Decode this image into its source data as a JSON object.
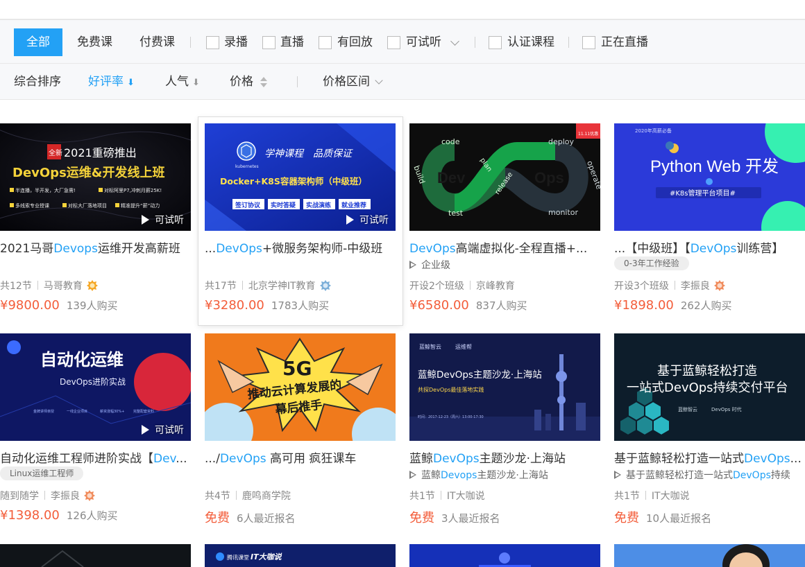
{
  "filters": {
    "all": "全部",
    "free": "免费课",
    "paid": "付费课",
    "recorded": "录播",
    "live": "直播",
    "replay": "有回放",
    "trial": "可试听",
    "certified": "认证课程",
    "live_now": "正在直播"
  },
  "sort": {
    "overall": "综合排序",
    "rating": "好评率",
    "popularity": "人气",
    "price": "价格",
    "price_range": "价格区间",
    "active": "rating"
  },
  "colors": {
    "accent": "#23a1f5",
    "price": "#f35d3a"
  },
  "courses": [
    {
      "title_parts": [
        "2021马哥",
        "Devops",
        "运维开发高薪班"
      ],
      "thumb": {
        "badge": "全新",
        "line1": "2021重磅推出",
        "line2": "DevOps运维&开发线上班",
        "bullets": [
          "半连播，半开发，大厂急需!",
          "对标阿里P7,冲刺月薪25K!",
          "多线索专业授课",
          "对标大厂落地项目",
          "精准提升“薪”动力"
        ]
      },
      "trial": "可试听",
      "meta": [
        "共12节",
        "马哥教育"
      ],
      "price": "¥9800.00",
      "buyers": "139人购买"
    },
    {
      "title_parts": [
        "...",
        "DevOps",
        "+微服务架构师-中级班"
      ],
      "thumb": {
        "logo": "kubernetes",
        "headline": "学神课程　品质保证",
        "line2": "Docker+K8S容器架构师（中级班）",
        "chips": [
          "签订协议",
          "实时答疑",
          "实战演练",
          "就业推荐"
        ]
      },
      "trial": "可试听",
      "meta": [
        "共17节",
        "北京学神IT教育"
      ],
      "price": "¥3280.00",
      "buyers": "1783人购买"
    },
    {
      "title_parts": [
        "",
        "DevOps",
        "高端虚拟化-全程直播+..."
      ],
      "thumb": {
        "words": [
          "code",
          "build",
          "plan",
          "test",
          "release",
          "deploy",
          "operate",
          "monitor",
          "Dev",
          "Ops"
        ],
        "corner": "11.11优惠"
      },
      "sub": "企业级",
      "meta": [
        "开设2个班级",
        "京峰教育"
      ],
      "price": "¥6580.00",
      "buyers": "837人购买"
    },
    {
      "title_parts": [
        "...【中级班】【",
        "DevOps",
        "训练营】"
      ],
      "thumb": {
        "top": "2020年高薪必备",
        "headline": "Python Web 开发",
        "sub": "#K8s管理平台项目#"
      },
      "tag": "0-3年工作经验",
      "meta": [
        "开设3个班级",
        "李振良"
      ],
      "price": "¥1898.00",
      "buyers": "262人购买"
    },
    {
      "title_parts": [
        "自动化运维工程师进阶实战【",
        "Dev",
        "..."
      ],
      "thumb": {
        "headline": "自动化运维",
        "sub": "DevOps进阶实战",
        "chips": [
          "金牌讲师亲授",
          "一线企业项目",
          "薪资涨幅30%+",
          "完整配套资料"
        ]
      },
      "trial": "可试听",
      "tag": "Linux运维工程师",
      "meta": [
        "随到随学",
        "李振良"
      ],
      "price": "¥1398.00",
      "buyers": "126人购买"
    },
    {
      "title_parts": [
        ".../",
        "DevOps",
        " 高可用 疯狂课车"
      ],
      "thumb": {
        "big": "5G",
        "line1": "推动云计算发展的",
        "line2": "幕后推手"
      },
      "meta": [
        "共4节",
        "鹿鸣商学院"
      ],
      "price": "免费",
      "buyers": "6人最近报名"
    },
    {
      "title_parts": [
        "蓝鲸",
        "DevOps",
        "主题沙龙·上海站"
      ],
      "thumb": {
        "brand": "蓝鲸智云",
        "brand2": "运维帮",
        "headline": "蓝鲸DevOps主题沙龙·上海站",
        "sub": "共探DevOps最佳落地实践",
        "time": "时间：2017-12-23（周六）13:00-17:30"
      },
      "sub_parts": [
        "蓝鲸",
        "Devops",
        "主题沙龙·上海站"
      ],
      "meta": [
        "共1节",
        "IT大咖说"
      ],
      "price": "免费",
      "buyers": "3人最近报名"
    },
    {
      "title_parts": [
        "基于蓝鲸轻松打造一站式",
        "DevOps",
        "..."
      ],
      "thumb": {
        "line1": "基于蓝鲸轻松打造",
        "line2": "一站式DevOps持续交付平台",
        "brand": "蓝鲸智云",
        "brand2": "DevOps 时代"
      },
      "sub_parts": [
        "基于蓝鲸轻松打造一站式",
        "DevOps",
        "持续"
      ],
      "meta": [
        "共1节",
        "IT大咖说"
      ],
      "price": "免费",
      "buyers": "10人最近报名"
    }
  ],
  "row3": {
    "brand_a": "腾讯课堂",
    "brand_b": "IT大咖说"
  }
}
